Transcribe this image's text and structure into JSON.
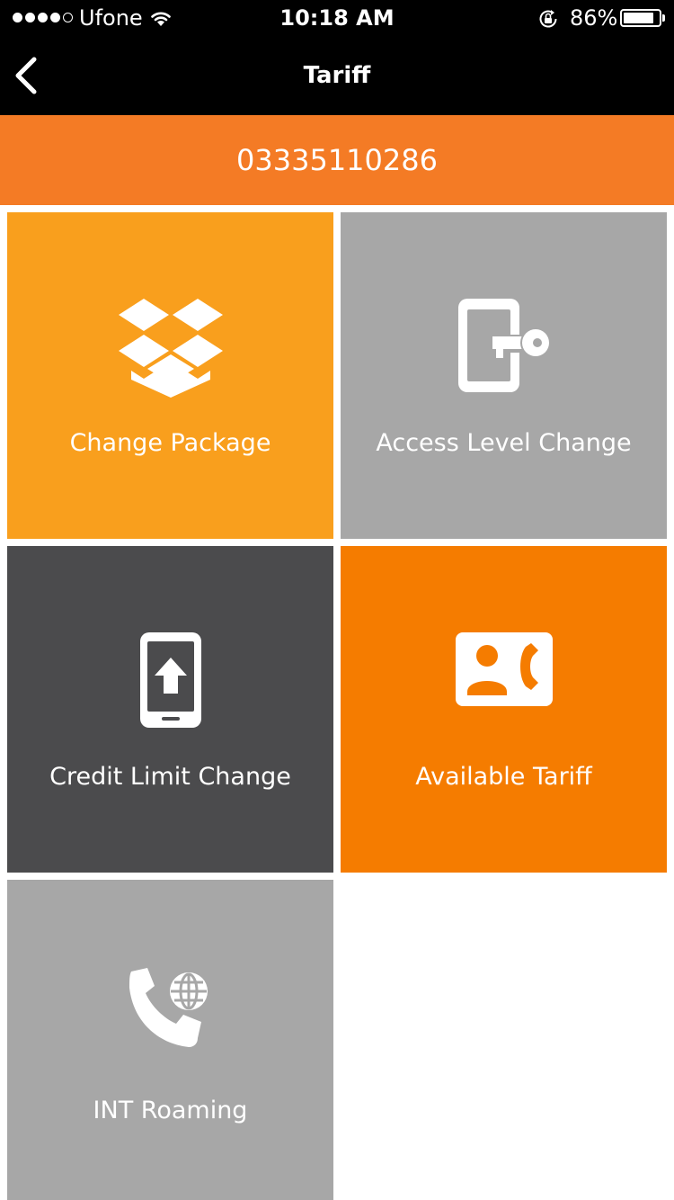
{
  "status_bar": {
    "carrier": "Ufone",
    "time": "10:18 AM",
    "battery_percent": "86%",
    "signal_bars": 4,
    "signal_max": 5,
    "battery_level": 0.86
  },
  "nav": {
    "title": "Tariff",
    "back_icon": "chevron-left-icon"
  },
  "msisdn": "03335110286",
  "tiles": [
    {
      "label": "Change Package",
      "icon": "box-package-icon",
      "color": "#f99f1d"
    },
    {
      "label": "Access Level Change",
      "icon": "phone-key-icon",
      "color": "#a7a7a7"
    },
    {
      "label": "Credit Limit Change",
      "icon": "phone-upload-icon",
      "color": "#4b4b4d"
    },
    {
      "label": "Available Tariff",
      "icon": "contact-call-card-icon",
      "color": "#f57c00"
    },
    {
      "label": "INT Roaming",
      "icon": "phone-globe-icon",
      "color": "#a7a7a7"
    }
  ],
  "colors": {
    "bar_background": "#000000",
    "accent_orange": "#f47b25"
  }
}
